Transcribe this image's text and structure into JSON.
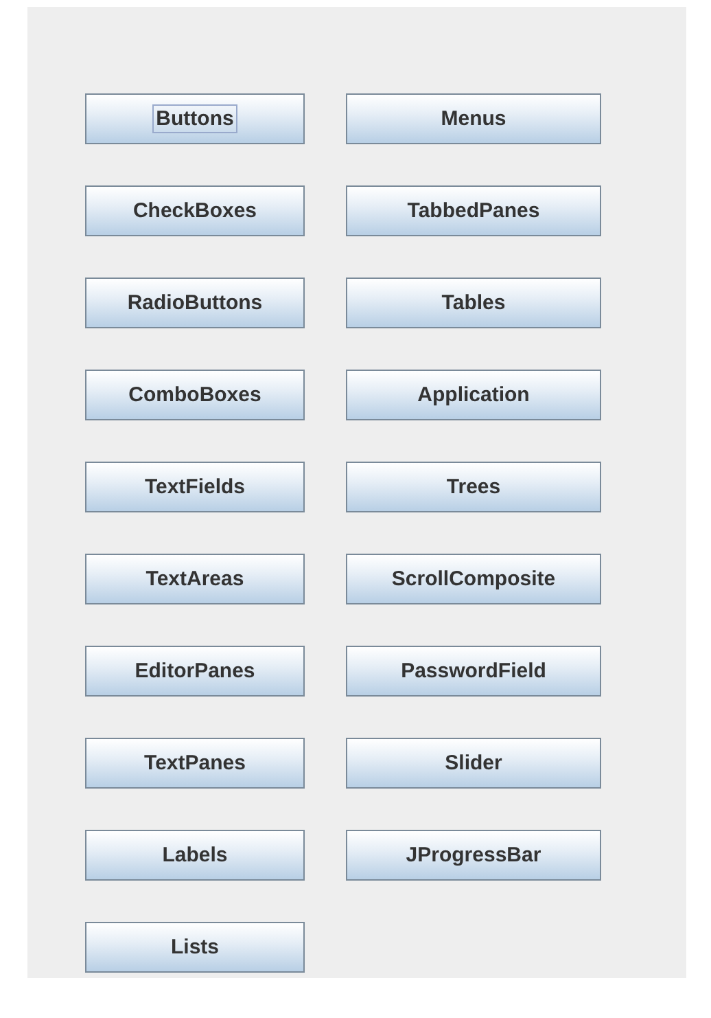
{
  "columns": [
    {
      "buttons": [
        {
          "label": "Buttons",
          "focused": true
        },
        {
          "label": "CheckBoxes",
          "focused": false
        },
        {
          "label": "RadioButtons",
          "focused": false
        },
        {
          "label": "ComboBoxes",
          "focused": false
        },
        {
          "label": "TextFields",
          "focused": false
        },
        {
          "label": "TextAreas",
          "focused": false
        },
        {
          "label": "EditorPanes",
          "focused": false
        },
        {
          "label": "TextPanes",
          "focused": false
        },
        {
          "label": "Labels",
          "focused": false
        },
        {
          "label": "Lists",
          "focused": false
        }
      ]
    },
    {
      "buttons": [
        {
          "label": "Menus",
          "focused": false
        },
        {
          "label": "TabbedPanes",
          "focused": false
        },
        {
          "label": "Tables",
          "focused": false
        },
        {
          "label": "Application",
          "focused": false
        },
        {
          "label": "Trees",
          "focused": false
        },
        {
          "label": "ScrollComposite",
          "focused": false
        },
        {
          "label": "PasswordField",
          "focused": false
        },
        {
          "label": "Slider",
          "focused": false
        },
        {
          "label": "JProgressBar",
          "focused": false
        }
      ]
    }
  ]
}
